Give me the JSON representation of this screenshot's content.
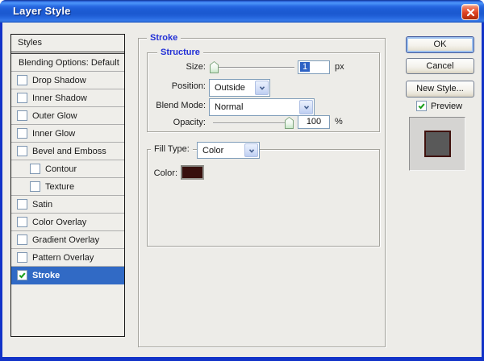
{
  "window": {
    "title": "Layer Style"
  },
  "sidebar": {
    "header": "Styles",
    "items": [
      {
        "label": "Blending Options: Default",
        "checkbox": false,
        "checked": false,
        "indent": false,
        "selected": false
      },
      {
        "label": "Drop Shadow",
        "checkbox": true,
        "checked": false,
        "indent": false,
        "selected": false
      },
      {
        "label": "Inner Shadow",
        "checkbox": true,
        "checked": false,
        "indent": false,
        "selected": false
      },
      {
        "label": "Outer Glow",
        "checkbox": true,
        "checked": false,
        "indent": false,
        "selected": false
      },
      {
        "label": "Inner Glow",
        "checkbox": true,
        "checked": false,
        "indent": false,
        "selected": false
      },
      {
        "label": "Bevel and Emboss",
        "checkbox": true,
        "checked": false,
        "indent": false,
        "selected": false
      },
      {
        "label": "Contour",
        "checkbox": true,
        "checked": false,
        "indent": true,
        "selected": false
      },
      {
        "label": "Texture",
        "checkbox": true,
        "checked": false,
        "indent": true,
        "selected": false
      },
      {
        "label": "Satin",
        "checkbox": true,
        "checked": false,
        "indent": false,
        "selected": false
      },
      {
        "label": "Color Overlay",
        "checkbox": true,
        "checked": false,
        "indent": false,
        "selected": false
      },
      {
        "label": "Gradient Overlay",
        "checkbox": true,
        "checked": false,
        "indent": false,
        "selected": false
      },
      {
        "label": "Pattern Overlay",
        "checkbox": true,
        "checked": false,
        "indent": false,
        "selected": false
      },
      {
        "label": "Stroke",
        "checkbox": true,
        "checked": true,
        "indent": false,
        "selected": true
      }
    ]
  },
  "main": {
    "group_title": "Stroke",
    "structure": {
      "title": "Structure",
      "size_label": "Size:",
      "size_value": "1",
      "size_unit": "px",
      "position_label": "Position:",
      "position_value": "Outside",
      "blend_mode_label": "Blend Mode:",
      "blend_mode_value": "Normal",
      "opacity_label": "Opacity:",
      "opacity_value": "100",
      "opacity_unit": "%"
    },
    "fill": {
      "fill_type_label": "Fill Type:",
      "fill_type_value": "Color",
      "color_label": "Color:"
    }
  },
  "actions": {
    "ok_label": "OK",
    "cancel_label": "Cancel",
    "new_style_label": "New Style...",
    "preview_label": "Preview"
  },
  "colors": {
    "titlebar_blue": "#1b59d0",
    "selection_blue": "#316ac5",
    "group_label_blue": "#2230d6",
    "stroke_swatch": "#38100e",
    "preview_fill_gray": "#595959",
    "dialog_background": "#edece8"
  }
}
